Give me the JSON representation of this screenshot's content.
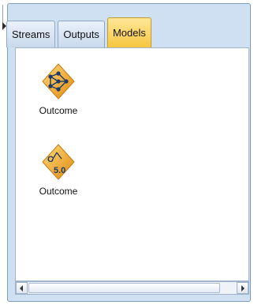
{
  "tabs": [
    {
      "label": "Streams",
      "active": false
    },
    {
      "label": "Outputs",
      "active": false
    },
    {
      "label": "Models",
      "active": true
    }
  ],
  "models": [
    {
      "label": "Outcome",
      "icon": "neural-network-model-icon"
    },
    {
      "label": "Outcome",
      "icon": "c50-model-icon",
      "badge": "C5.0"
    }
  ],
  "colors": {
    "active_tab": "#f7c640",
    "panel_bg": "#cfe0f3",
    "nugget_gold": "#f0a830"
  }
}
